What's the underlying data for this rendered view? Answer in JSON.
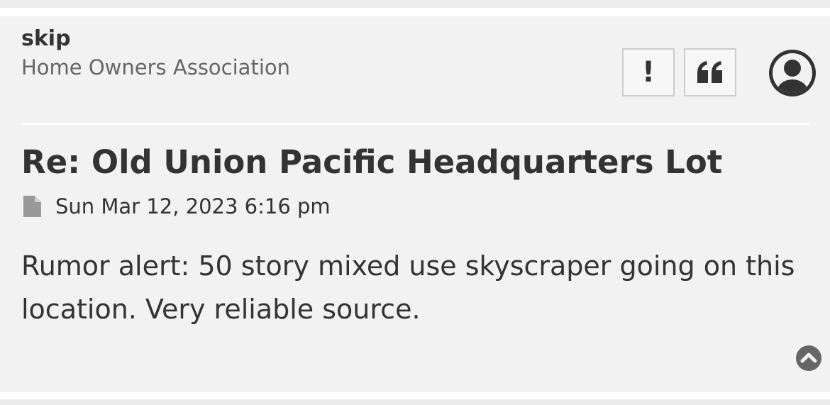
{
  "post": {
    "author": {
      "name": "skip",
      "rank": "Home Owners Association"
    },
    "title": "Re: Old Union Pacific Headquarters Lot",
    "date": "Sun Mar 12, 2023 6:16 pm",
    "content": "Rumor alert: 50 story mixed use skyscraper going on this location. Very reliable source.",
    "actions": {
      "report_icon": "exclamation-icon",
      "report_glyph": "!",
      "quote_icon": "quote-icon"
    },
    "avatar_icon": "user-avatar-icon",
    "meta_icon": "file-icon",
    "back_to_top_icon": "chevron-up-circle-icon"
  },
  "colors": {
    "page_background": "#ffffff",
    "post_background": "#f2f2f2",
    "strip": "#ececec",
    "text": "#333333",
    "muted_text": "#666666",
    "button_border": "#cccccc",
    "icon_gray": "#999999"
  }
}
